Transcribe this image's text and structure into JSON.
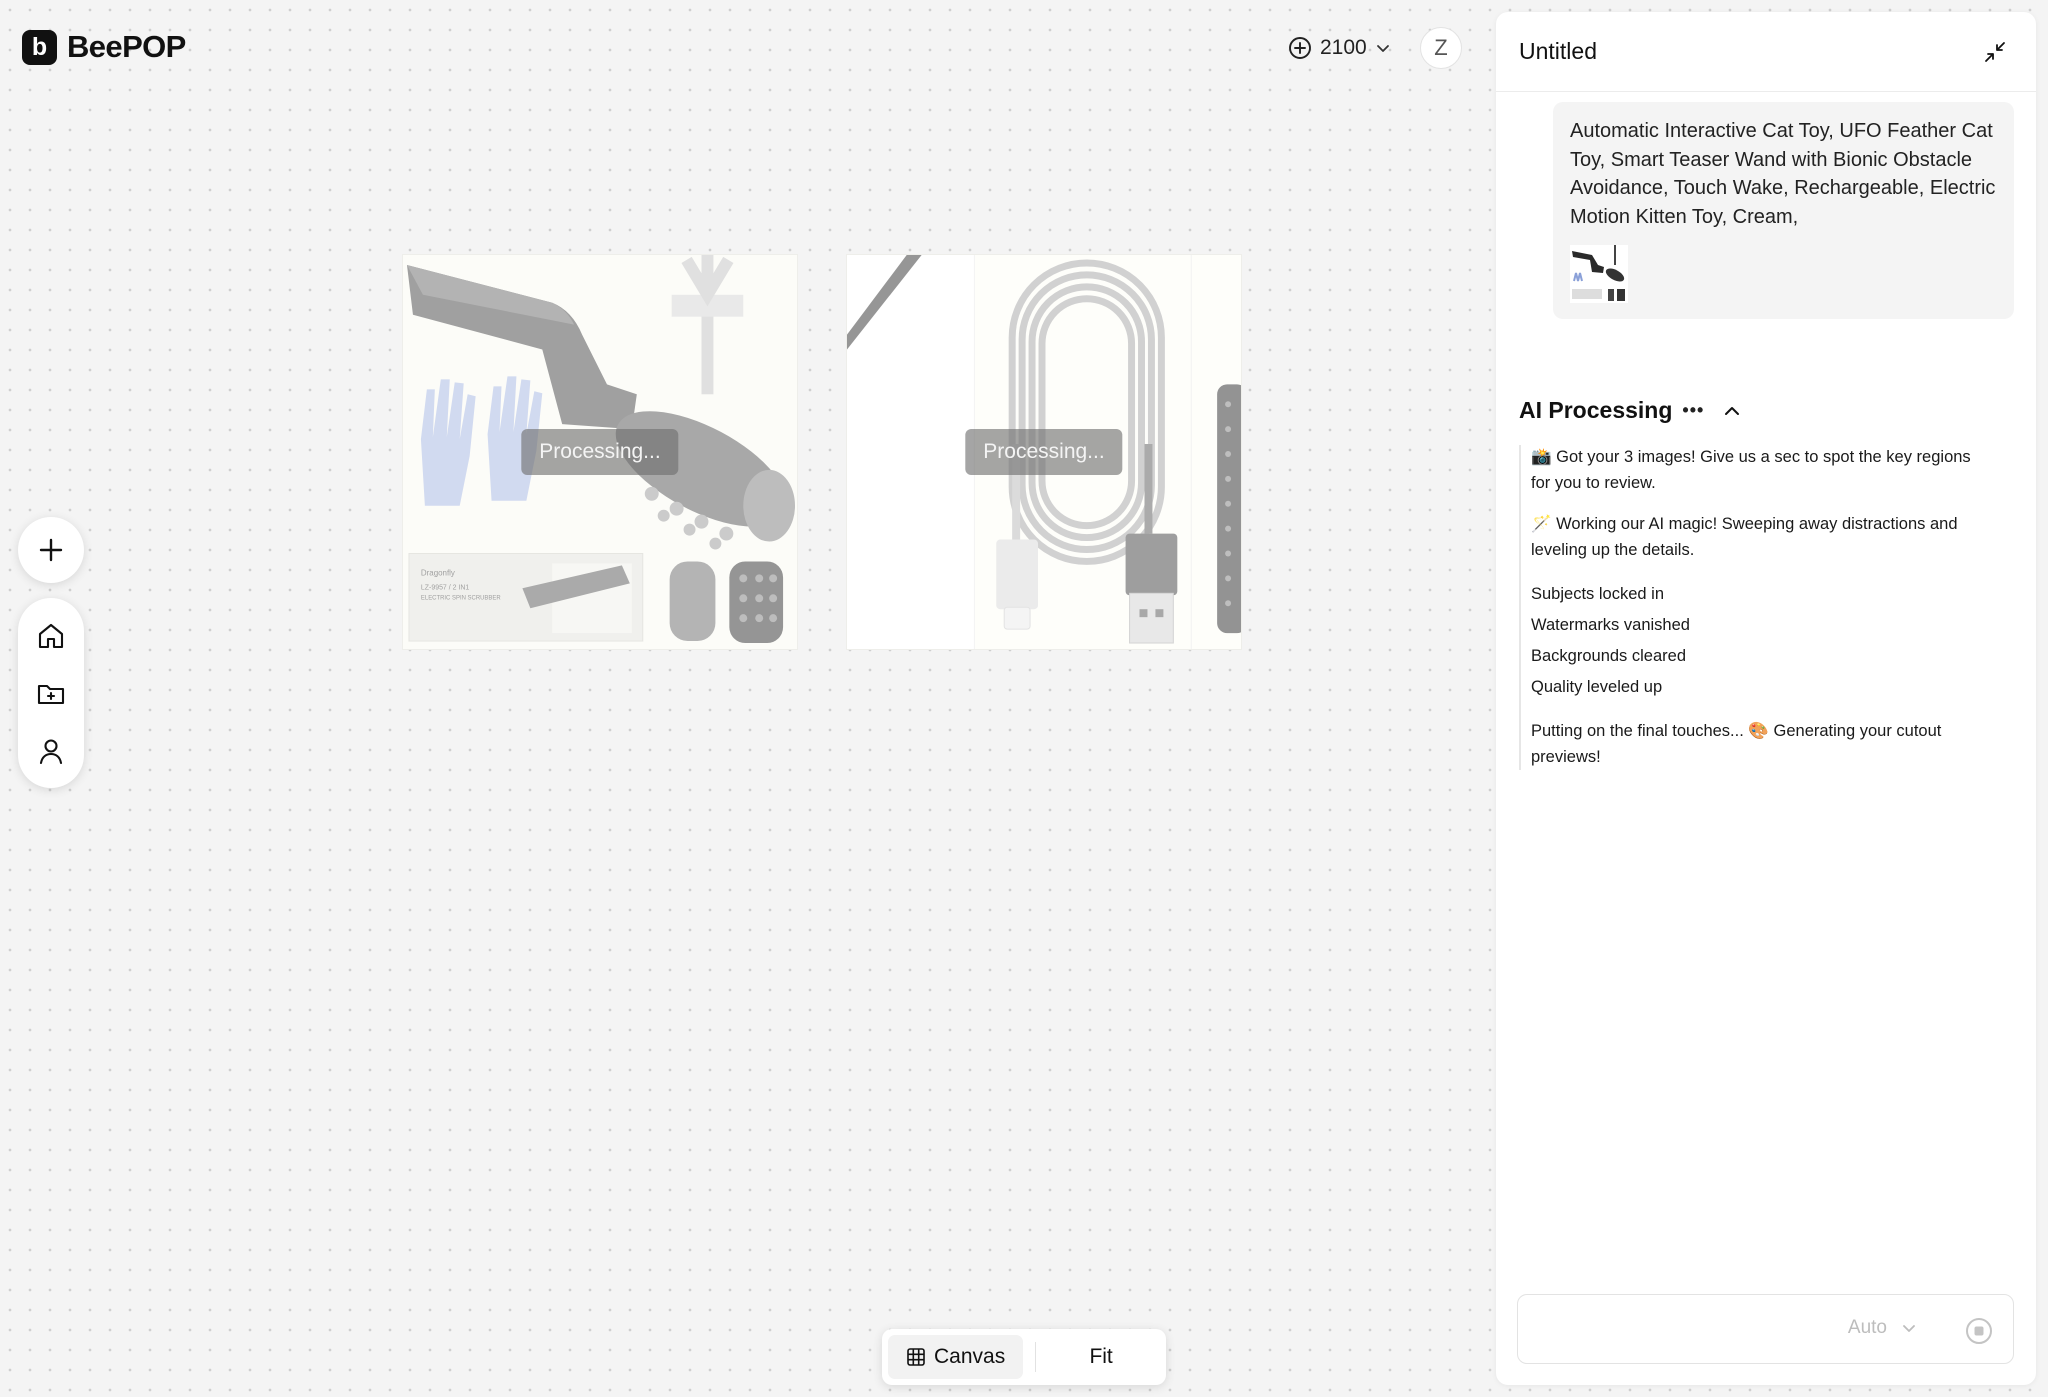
{
  "app": {
    "logo_glyph": "b",
    "name": "BeePOP"
  },
  "topbar": {
    "credits": "2100",
    "credits_icon": "plus-circle-icon",
    "user_initial": "Z"
  },
  "sidebar": {
    "add_icon": "plus-icon",
    "items": [
      {
        "id": "home",
        "icon": "home-icon"
      },
      {
        "id": "projects",
        "icon": "folder-icon"
      },
      {
        "id": "account",
        "icon": "user-icon"
      }
    ]
  },
  "canvas": {
    "images": [
      {
        "status": "Processing..."
      },
      {
        "status": "Processing..."
      }
    ],
    "product_box_text": [
      "Dragonfly",
      "LZ-9957 / 2 IN1",
      "ELECTRIC SPIN SCRUBBER"
    ]
  },
  "bottombar": {
    "canvas_label": "Canvas",
    "fit_label": "Fit"
  },
  "panel": {
    "title": "Untitled",
    "user_message": "Automatic Interactive Cat Toy, UFO Feather Cat Toy, Smart Teaser Wand with Bionic Obstacle Avoidance, Touch Wake, Rechargeable, Electric Motion Kitten Toy, Cream,",
    "ai": {
      "title": "AI Processing",
      "dots": "•••",
      "log": {
        "step1": "📸 Got your 3 images!  Give us a sec to spot the key regions for you to review.",
        "step2": "🪄 Working our AI magic!  Sweeping away distractions and leveling up the details.",
        "checks": [
          "Subjects locked in",
          "Watermarks vanished",
          "Backgrounds cleared",
          "Quality leveled up"
        ],
        "step3": "Putting on the final touches... 🎨 Generating your cutout previews!"
      }
    },
    "input": {
      "mode": "Auto"
    }
  },
  "colors": {
    "accent": "#111111",
    "panel_bg": "#ffffff",
    "canvas_bg": "#f4f4f4",
    "muted": "#bdbdbd"
  }
}
